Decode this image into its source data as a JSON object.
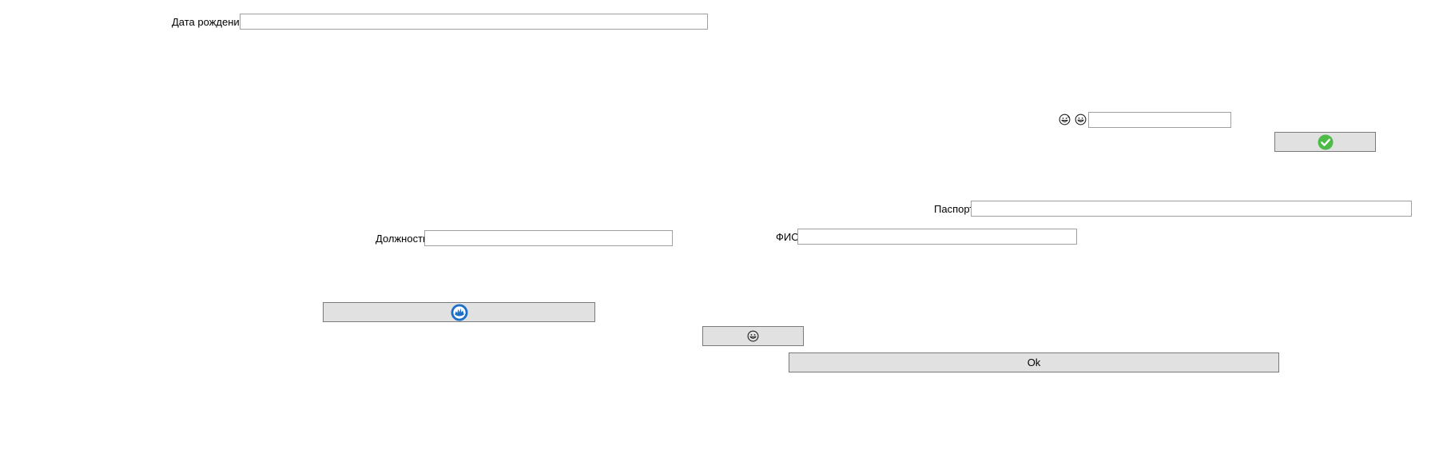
{
  "form": {
    "birth_date": {
      "label": "Дата рождения",
      "value": ""
    },
    "emoji_field": {
      "value": ""
    },
    "passport": {
      "label": "Паспорт",
      "value": ""
    },
    "position": {
      "label": "Должность",
      "value": ""
    },
    "full_name": {
      "label": "ФИО",
      "value": ""
    }
  },
  "buttons": {
    "confirm": {
      "icon": "green-check-circle-icon",
      "color": "#4cbb47"
    },
    "blue": {
      "icon": "blue-circle-hand-icon",
      "color": "#1e6fc8"
    },
    "emoji": {
      "icon": "grinning-face-icon"
    },
    "ok": {
      "label": "Ok"
    }
  },
  "icons": {
    "face_1": "grinning-sweat-face-icon",
    "face_2": "grinning-face-icon"
  }
}
